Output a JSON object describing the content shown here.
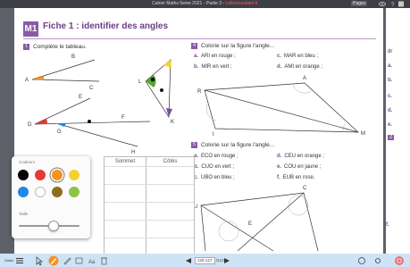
{
  "window": {
    "title_prefix": "Cahier Maths 5eme 2021 - Partie 3 - ",
    "title_accent": "Lelivrescolaire.fr",
    "ctl_left": "Pages",
    "ctl_icons": [
      "eye-icon",
      "help-icon",
      "close-icon"
    ]
  },
  "page": {
    "badge": "M1",
    "title": "Fiche 1 : identifier des angles",
    "ex1": {
      "num": "1",
      "text": "Complète le tableau."
    },
    "ex4": {
      "num": "4",
      "text": "Colorie sur la figure l'angle...",
      "items": [
        {
          "letter": "a.",
          "text": "ARI en rouge ;"
        },
        {
          "letter": "c.",
          "text": "MAR en bleu ;"
        },
        {
          "letter": "b.",
          "text": "MIR en vert ;"
        },
        {
          "letter": "d.",
          "text": "AMI en orange ;"
        }
      ]
    },
    "ex5": {
      "num": "5",
      "text": "Colorie sur la figure l'angle...",
      "items": [
        {
          "letter": "a.",
          "text": "ECO en rouge ;"
        },
        {
          "letter": "d.",
          "text": "CEU en orange ;"
        },
        {
          "letter": "b.",
          "text": "CUO en vert ;"
        },
        {
          "letter": "e.",
          "text": "COU en jaune ;"
        },
        {
          "letter": "c.",
          "text": "UBO en bleu ;"
        },
        {
          "letter": "f.",
          "text": "EUB en rose."
        }
      ]
    },
    "table": {
      "col2": "Sommet",
      "col3": "Côtés"
    },
    "points": {
      "A": "A",
      "B": "B",
      "C": "C",
      "D": "D",
      "E": "E",
      "F": "F",
      "G": "G",
      "H": "H",
      "K": "K",
      "L": "L",
      "M": "M",
      "R": "R",
      "I": "I",
      "U": "U",
      "Cpt": "C"
    }
  },
  "side_page": {
    "lines": [
      "dr",
      "a.",
      "b.",
      "c.",
      "d.",
      "e.",
      "2",
      "f."
    ]
  },
  "palette": {
    "colors_label": "Couleurs",
    "size_label": "Taille",
    "colors": [
      "#000000",
      "#e53935",
      "#f7931e",
      "#f5d033",
      "#1e88e5",
      "#ffffff",
      "#8d6e1e",
      "#8bc34a"
    ],
    "selected": "#f7931e",
    "size_level": 0.6
  },
  "bottombar": {
    "left_label": "Outils",
    "page_current": "126-127",
    "page_total": "/212",
    "icons": [
      "menu-icon",
      "pointer-icon",
      "pen-icon",
      "highlighter-icon",
      "rectangle-icon",
      "text-icon",
      "trash-icon",
      "prev-page-icon",
      "next-page-icon",
      "zoom-icon",
      "settings-icon",
      "fullscreen-icon"
    ]
  }
}
